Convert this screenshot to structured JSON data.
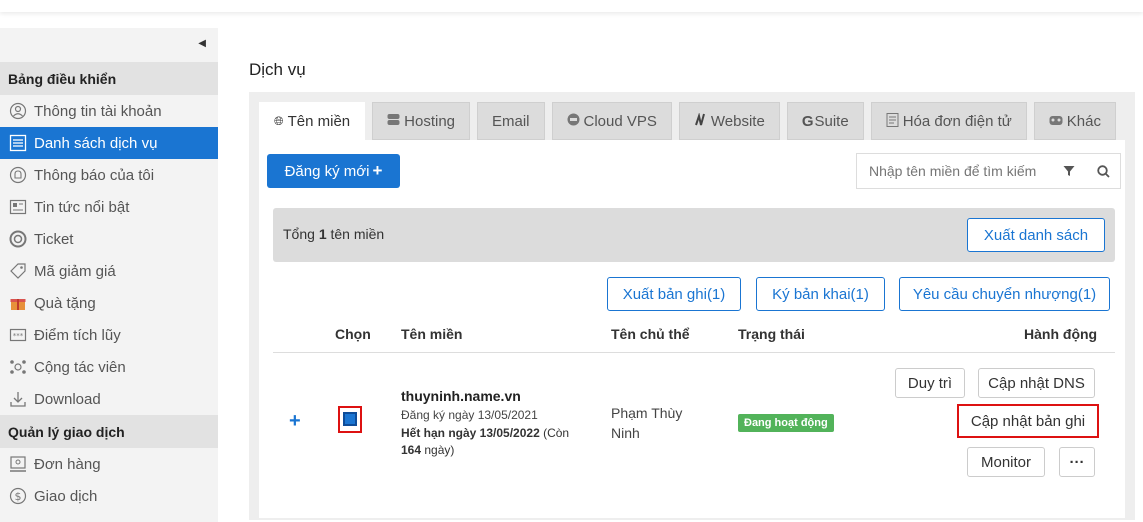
{
  "sidebar": {
    "collapse_icon": "caret-left-icon",
    "sections": [
      {
        "title": "Bảng điều khiển"
      },
      {
        "title": "Quản lý giao dịch"
      }
    ],
    "items": [
      {
        "label": "Thông tin tài khoản",
        "icon": "account-icon"
      },
      {
        "label": "Danh sách dịch vụ",
        "icon": "list-icon",
        "active": true
      },
      {
        "label": "Thông báo của tôi",
        "icon": "bell-icon"
      },
      {
        "label": "Tin tức nổi bật",
        "icon": "news-icon"
      },
      {
        "label": "Ticket",
        "icon": "lifebuoy-icon"
      },
      {
        "label": "Mã giảm giá",
        "icon": "coupon-icon"
      },
      {
        "label": "Quà tặng",
        "icon": "gift-icon"
      },
      {
        "label": "Điểm tích lũy",
        "icon": "points-icon"
      },
      {
        "label": "Cộng tác viên",
        "icon": "affiliate-icon"
      },
      {
        "label": "Download",
        "icon": "download-icon"
      },
      {
        "label": "Đơn hàng",
        "icon": "order-icon"
      },
      {
        "label": "Giao dịch",
        "icon": "dollar-icon"
      }
    ]
  },
  "page": {
    "title": "Dịch vụ"
  },
  "tabs": [
    {
      "label": "Tên miền",
      "icon": "globe-icon",
      "active": true
    },
    {
      "label": "Hosting",
      "icon": "server-icon"
    },
    {
      "label": "Email",
      "icon": ""
    },
    {
      "label": "Cloud VPS",
      "icon": "cloud-icon"
    },
    {
      "label": "Website",
      "icon": "website-icon"
    },
    {
      "label": "Suite",
      "icon": "g-icon"
    },
    {
      "label": "Hóa đơn điện tử",
      "icon": "invoice-icon"
    },
    {
      "label": "Khác",
      "icon": "other-icon"
    }
  ],
  "toolbar": {
    "register_label": "Đăng ký mới",
    "search_placeholder": "Nhập tên miền để tìm kiếm"
  },
  "summary": {
    "prefix": "Tổng ",
    "count": "1",
    "suffix": " tên miền",
    "export_list_label": "Xuất danh sách"
  },
  "bulk_actions": {
    "export_records": "Xuất bản ghi(1)",
    "sign_declaration": "Ký bản khai(1)",
    "transfer_request": "Yêu cầu chuyển nhượng(1)"
  },
  "table": {
    "columns": [
      "Chọn",
      "Tên miền",
      "Tên chủ thể",
      "Trạng thái",
      "Hành động"
    ],
    "rows": [
      {
        "domain": "thuyninh.name.vn",
        "registered": "Đăng ký ngày 13/05/2021",
        "expires": "Hết hạn ngày 13/05/2022",
        "remaining_prefix": " (Còn ",
        "remaining_days": "164",
        "remaining_suffix": " ngày)",
        "owner": "Phạm Thùy Ninh",
        "status": "Đang hoạt động",
        "actions": {
          "maintain": "Duy trì",
          "update_dns": "Cập nhật DNS",
          "update_records": "Cập nhật bản ghi",
          "monitor": "Monitor",
          "more": "···"
        }
      }
    ]
  },
  "colors": {
    "accent": "#1a75d2",
    "status_active": "#52b35a",
    "highlight": "#dd1111"
  }
}
